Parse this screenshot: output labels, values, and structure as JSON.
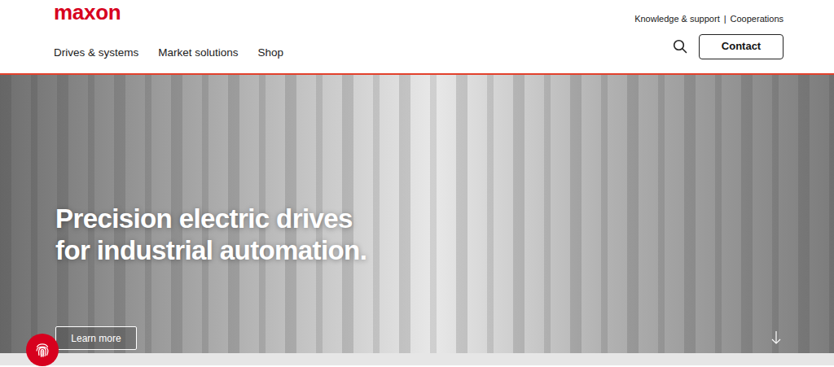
{
  "logo": "maxon",
  "top_links": {
    "items": [
      "Knowledge & support",
      "Cooperations"
    ],
    "separator": "|"
  },
  "nav": [
    "Drives & systems",
    "Market solutions",
    "Shop"
  ],
  "contact": "Contact",
  "hero": {
    "headline": [
      "Precision electric drives",
      "for industrial automation."
    ],
    "button": "Learn more"
  }
}
